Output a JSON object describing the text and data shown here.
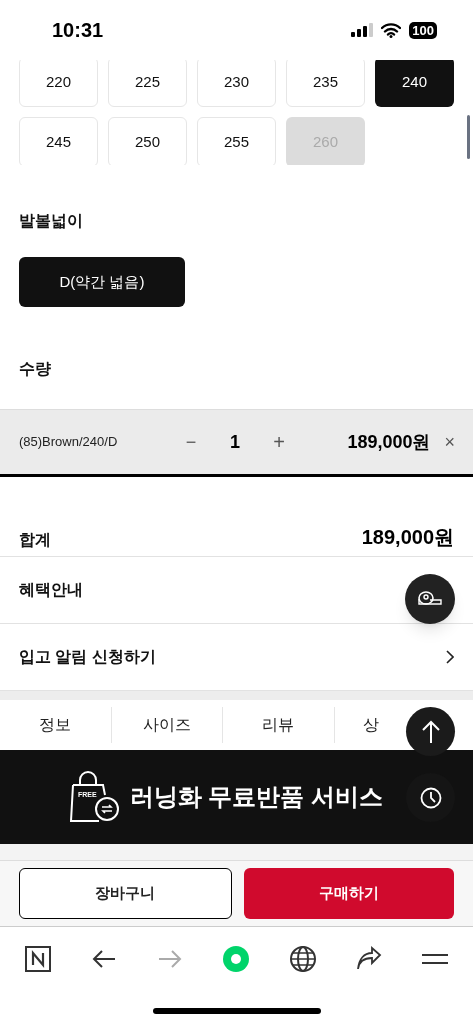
{
  "status_bar": {
    "time": "10:31",
    "battery": "100"
  },
  "sizes": [
    {
      "label": "220",
      "selected": false,
      "disabled": false
    },
    {
      "label": "225",
      "selected": false,
      "disabled": false
    },
    {
      "label": "230",
      "selected": false,
      "disabled": false
    },
    {
      "label": "235",
      "selected": false,
      "disabled": false
    },
    {
      "label": "240",
      "selected": true,
      "disabled": false
    },
    {
      "label": "245",
      "selected": false,
      "disabled": false
    },
    {
      "label": "250",
      "selected": false,
      "disabled": false
    },
    {
      "label": "255",
      "selected": false,
      "disabled": false
    },
    {
      "label": "260",
      "selected": false,
      "disabled": true
    }
  ],
  "width_section": {
    "heading": "발볼넓이",
    "options": [
      {
        "label": "D(약간 넓음)",
        "selected": true
      }
    ]
  },
  "quantity_section": {
    "heading": "수량"
  },
  "item": {
    "option": "(85)Brown/240/D",
    "minus": "−",
    "quantity": "1",
    "plus": "+",
    "price": "189,000원",
    "remove": "×"
  },
  "total": {
    "label": "합계",
    "amount": "189,000원"
  },
  "links": [
    {
      "label": "혜택안내",
      "chevron": false
    },
    {
      "label": "입고 알림 신청하기",
      "chevron": true
    }
  ],
  "tabs": [
    {
      "label": "정보"
    },
    {
      "label": "사이즈"
    },
    {
      "label": "리뷰"
    },
    {
      "label": "상"
    }
  ],
  "banner": {
    "badge": "FREE",
    "text": "러닝화 무료반품 서비스"
  },
  "actions": {
    "cart": "장바구니",
    "buy": "구매하기"
  },
  "toolbar": [
    {
      "kind": "home"
    },
    {
      "kind": "back",
      "disabled": false
    },
    {
      "kind": "forward",
      "disabled": true
    },
    {
      "kind": "green"
    },
    {
      "kind": "globe"
    },
    {
      "kind": "share"
    },
    {
      "kind": "menu"
    }
  ]
}
